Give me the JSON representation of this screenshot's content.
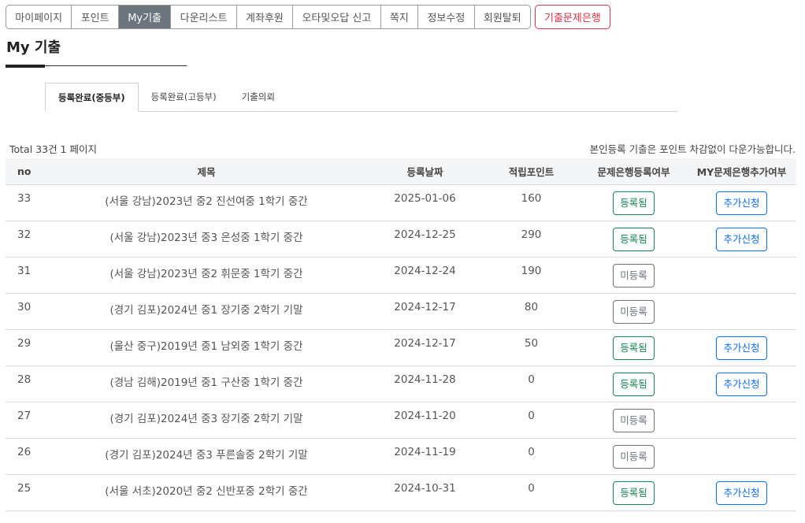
{
  "nav": {
    "items": [
      "마이페이지",
      "포인트",
      "My기출",
      "다운리스트",
      "계좌후원",
      "오타및오답 신고",
      "쪽지",
      "정보수정",
      "회원탈퇴"
    ],
    "active": "My기출",
    "bank_label": "기출문제은행",
    "bank_color": "#dc3545"
  },
  "page_title": "My 기출",
  "tabs": [
    "등록완료(중등부)",
    "등록완료(고등부)",
    "기출의뢰"
  ],
  "active_tab": "등록완료(중등부)",
  "summary": {
    "total": "Total 33건 1 페이지",
    "notice": "본인등록 기출은 포인트 차감없이 다운가능합니다."
  },
  "table": {
    "headers": [
      "no",
      "제목",
      "등록날짜",
      "적립포인트",
      "문제은행등록여부",
      "MY문제은행추가여부"
    ],
    "rows": [
      {
        "no": "33",
        "title": "(서울 강남)2023년 중2 진선여중 1학기 중간",
        "date": "2025-01-06",
        "points": "160",
        "status": "등록됨",
        "registered": true,
        "add": "추가신청"
      },
      {
        "no": "32",
        "title": "(서울 강남)2023년 중3 은성중 1학기 중간",
        "date": "2024-12-25",
        "points": "290",
        "status": "등록됨",
        "registered": true,
        "add": "추가신청"
      },
      {
        "no": "31",
        "title": "(서울 강남)2023년 중2 휘문중 1학기 중간",
        "date": "2024-12-24",
        "points": "190",
        "status": "미등록",
        "registered": false,
        "add": ""
      },
      {
        "no": "30",
        "title": "(경기 김포)2024년 중1 장기중 2학기 기말",
        "date": "2024-12-17",
        "points": "80",
        "status": "미등록",
        "registered": false,
        "add": ""
      },
      {
        "no": "29",
        "title": "(울산 중구)2019년 중1 남외중 1학기 중간",
        "date": "2024-12-17",
        "points": "50",
        "status": "등록됨",
        "registered": true,
        "add": "추가신청"
      },
      {
        "no": "28",
        "title": "(경남 김해)2019년 중1 구산중 1학기 중간",
        "date": "2024-11-28",
        "points": "0",
        "status": "등록됨",
        "registered": true,
        "add": "추가신청"
      },
      {
        "no": "27",
        "title": "(경기 김포)2024년 중3 장기중 2학기 기말",
        "date": "2024-11-20",
        "points": "0",
        "status": "미등록",
        "registered": false,
        "add": ""
      },
      {
        "no": "26",
        "title": "(경기 김포)2024년 중3 푸른솔중 2학기 기말",
        "date": "2024-11-19",
        "points": "0",
        "status": "미등록",
        "registered": false,
        "add": ""
      },
      {
        "no": "25",
        "title": "(서울 서초)2020년 중2 신반포중 2학기 중간",
        "date": "2024-10-31",
        "points": "0",
        "status": "등록됨",
        "registered": true,
        "add": "추가신청"
      }
    ]
  }
}
